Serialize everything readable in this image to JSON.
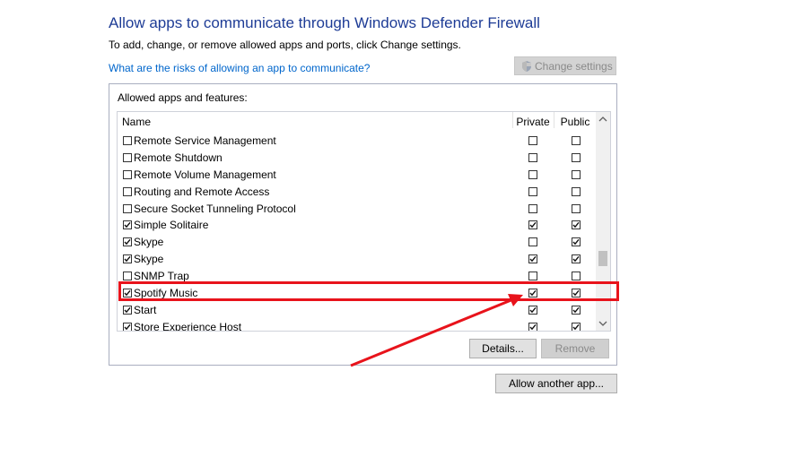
{
  "header": {
    "title": "Allow apps to communicate through Windows Defender Firewall",
    "subtitle": "To add, change, or remove allowed apps and ports, click Change settings.",
    "risk_link": "What are the risks of allowing an app to communicate?",
    "change_settings_label": "Change settings"
  },
  "group": {
    "label": "Allowed apps and features:"
  },
  "list": {
    "columns": {
      "name": "Name",
      "private": "Private",
      "public": "Public"
    },
    "rows": [
      {
        "name": "Remote Service Management",
        "enabled": false,
        "private": false,
        "public": false
      },
      {
        "name": "Remote Shutdown",
        "enabled": false,
        "private": false,
        "public": false
      },
      {
        "name": "Remote Volume Management",
        "enabled": false,
        "private": false,
        "public": false
      },
      {
        "name": "Routing and Remote Access",
        "enabled": false,
        "private": false,
        "public": false
      },
      {
        "name": "Secure Socket Tunneling Protocol",
        "enabled": false,
        "private": false,
        "public": false
      },
      {
        "name": "Simple Solitaire",
        "enabled": true,
        "private": true,
        "public": true
      },
      {
        "name": "Skype",
        "enabled": true,
        "private": false,
        "public": true
      },
      {
        "name": "Skype",
        "enabled": true,
        "private": true,
        "public": true
      },
      {
        "name": "SNMP Trap",
        "enabled": false,
        "private": false,
        "public": false
      },
      {
        "name": "Spotify Music",
        "enabled": true,
        "private": true,
        "public": true
      },
      {
        "name": "Start",
        "enabled": true,
        "private": true,
        "public": true
      },
      {
        "name": "Store Experience Host",
        "enabled": true,
        "private": true,
        "public": true
      }
    ]
  },
  "buttons": {
    "details": "Details...",
    "remove": "Remove",
    "allow_another": "Allow another app..."
  },
  "annotation": {
    "highlight_color": "#e8131b",
    "highlighted_row": "Spotify Music"
  },
  "icons": {
    "shield": "uac-shield-icon",
    "scroll_up": "chevron-up-icon",
    "scroll_down": "chevron-down-icon"
  }
}
